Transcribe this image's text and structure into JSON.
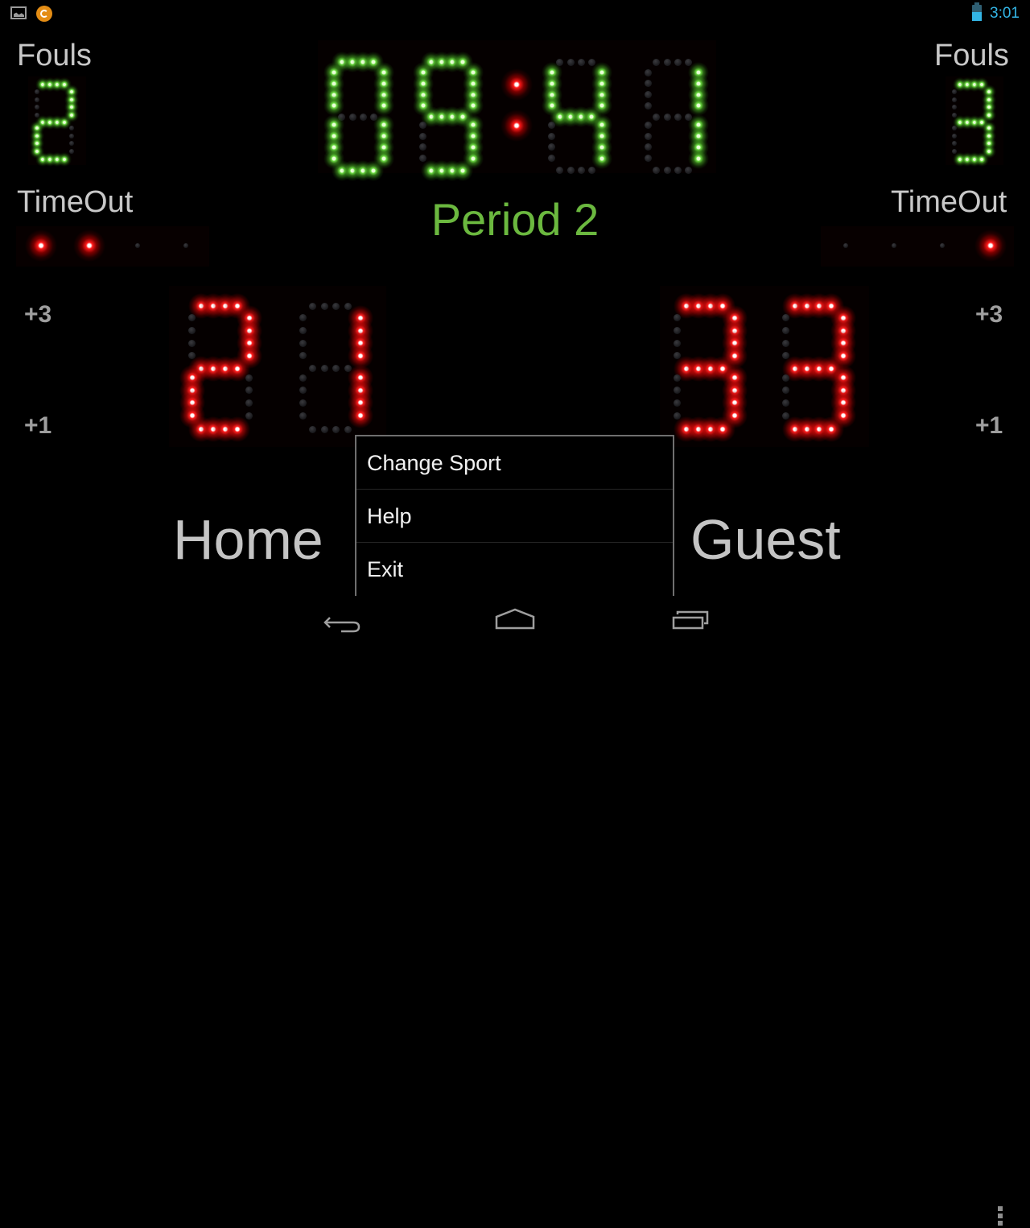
{
  "status_bar": {
    "left_icons": [
      "gallery-icon",
      "app-notification-icon"
    ],
    "battery_icon": "battery-icon",
    "time": "3:01",
    "accent_color": "#33b5e5"
  },
  "scoreboard": {
    "clock": {
      "minutes": "09",
      "seconds": "41",
      "separator": ":",
      "color": "#6fe045"
    },
    "period_label": "Period 2",
    "period_color": "#6bb83f",
    "home": {
      "name": "Home",
      "fouls_label": "Fouls",
      "fouls": "2",
      "timeout_label": "TimeOut",
      "timeouts_used": 2,
      "timeouts_total": 4,
      "score": "21",
      "plus3_label": "+3",
      "plus1_label": "+1"
    },
    "guest": {
      "name": "Guest",
      "fouls_label": "Fouls",
      "fouls": "3",
      "timeout_label": "TimeOut",
      "timeouts_used": 1,
      "timeouts_total": 4,
      "score": "33",
      "plus3_label": "+3",
      "plus1_label": "+1"
    },
    "score_color": "#ff2020"
  },
  "options_menu": {
    "items": [
      {
        "label": "Change Sport"
      },
      {
        "label": "Help"
      },
      {
        "label": "Exit"
      }
    ]
  },
  "nav_bar": {
    "buttons": [
      "back-icon",
      "home-icon",
      "recent-apps-icon"
    ],
    "overflow": "overflow-menu-icon"
  }
}
